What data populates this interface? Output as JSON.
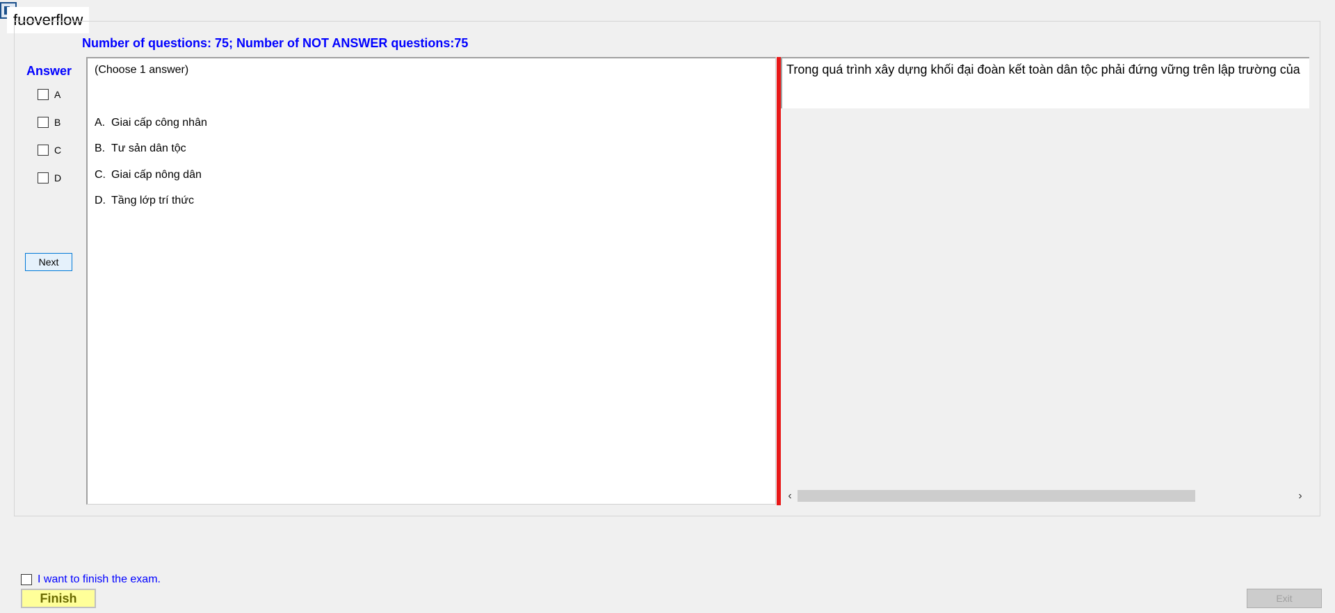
{
  "window": {
    "title": "fuoverflow"
  },
  "status": {
    "counter": "Number of questions: 75; Number of NOT ANSWER questions:75"
  },
  "answer_panel": {
    "title": "Answer",
    "options": [
      "A",
      "B",
      "C",
      "D"
    ],
    "next_label": "Next"
  },
  "question": {
    "instruction": "(Choose 1 answer)",
    "options": [
      {
        "letter": "A.",
        "text": "Giai cấp công nhân"
      },
      {
        "letter": "B.",
        "text": "Tư sản dân tộc"
      },
      {
        "letter": "C.",
        "text": "Giai cấp nông dân"
      },
      {
        "letter": "D.",
        "text": "Tầng lớp trí thức"
      }
    ],
    "text": "Trong quá trình xây dựng khối đại đoàn kết toàn dân tộc phải đứng vững trên lập trường của"
  },
  "footer": {
    "finish_check_label": "I want to finish the exam.",
    "finish_label": "Finish",
    "exit_label": "Exit"
  },
  "icons": {
    "scroll_left": "‹",
    "scroll_right": "›"
  }
}
